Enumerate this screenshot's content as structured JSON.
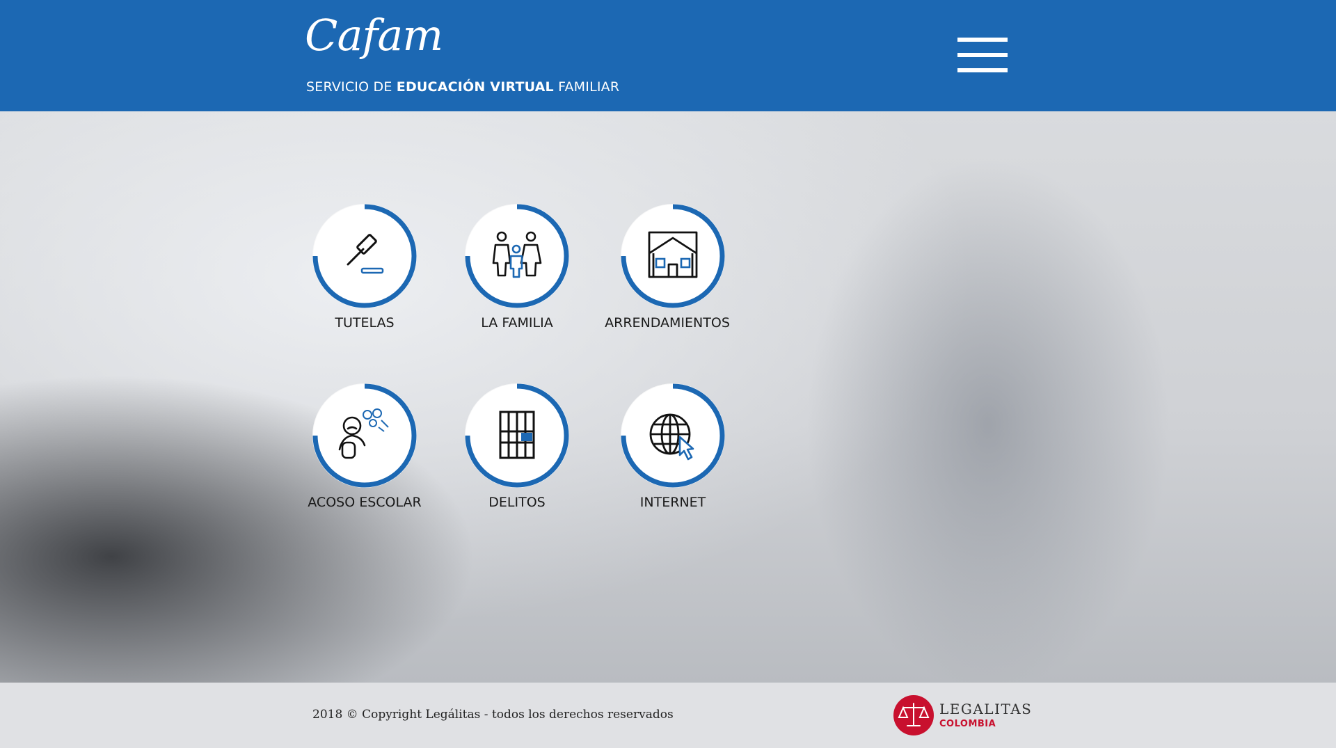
{
  "header": {
    "logo_text": "Cafam",
    "tagline_prefix": "SERVICIO DE ",
    "tagline_bold": "EDUCACIÓN VIRTUAL",
    "tagline_suffix": " FAMILIAR",
    "menu_icon": "hamburger-menu-icon"
  },
  "categories": [
    {
      "label": "TUTELAS",
      "icon": "gavel-icon"
    },
    {
      "label": "LA FAMILIA",
      "icon": "family-icon"
    },
    {
      "label": "ARRENDAMIENTOS",
      "icon": "house-icon"
    },
    {
      "label": "ACOSO ESCOLAR",
      "icon": "bullying-icon"
    },
    {
      "label": "DELITOS",
      "icon": "jail-cell-icon"
    },
    {
      "label": "INTERNET",
      "icon": "globe-cursor-icon"
    }
  ],
  "footer": {
    "copyright": "2018 © Copyright Legálitas - todos los derechos reservados",
    "brand_name": "LEGALITAS",
    "brand_sub": "COLOMBIA",
    "brand_icon": "scales-of-justice-icon"
  },
  "colors": {
    "header_blue": "#1c68b3",
    "ring_blue": "#1c68b3",
    "brand_red": "#c8102e",
    "footer_bg": "#e0e1e4"
  }
}
